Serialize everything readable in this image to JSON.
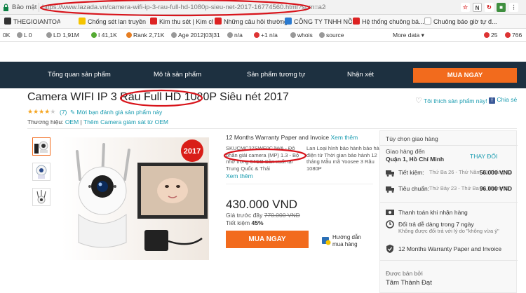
{
  "browser": {
    "secure_label": "Bảo mật",
    "url_domain": "https://www.lazada.vn",
    "url_path": "/camera-wifi-ip-3-rau-full-hd-1080p-sieu-net-2017-16774560.html?spm=a2o4n.search.products-list.31.20f9e719s9...",
    "colors": {
      "annotation": "#d8141b",
      "accent": "#f26b1d"
    }
  },
  "bookmarks": [
    {
      "label": "THEGIOIANTOAN.VN",
      "icon": "tgat-icon"
    },
    {
      "label": "Chống sét lan truyền",
      "icon": "bookmark-icon"
    },
    {
      "label": "Kim thu sét | Kim ch...",
      "icon": "bookmark-icon"
    },
    {
      "label": "Những câu hỏi thường...",
      "icon": "bookmark-icon"
    },
    {
      "label": "CÔNG TY TNHH NỒI...",
      "icon": "company-icon"
    },
    {
      "label": "Hệ thống chuông bá...",
      "icon": "bell-icon"
    },
    {
      "label": "Chuông báo giờ tự đ...",
      "icon": "page-icon"
    }
  ],
  "seobar": {
    "items": [
      "0K",
      "L 0",
      "LD 1,91M",
      "I 41,1K",
      "Rank 2,71K",
      "Age 2012|03|31",
      "n/a",
      "+1 n/a",
      "whois",
      "source",
      "More data ▾",
      "25",
      "766"
    ]
  },
  "nav": {
    "items": [
      "Tổng quan sản phẩm",
      "Mô tả sản phẩm",
      "Sản phẩm tương tự",
      "Nhận xét"
    ],
    "buy_label": "MUA NGAY"
  },
  "product": {
    "title": "Camera WIFI IP 3 Râu Full HD 1080P Siêu nét 2017",
    "rating_stars": 4,
    "rating_count": "(7)",
    "ask_label": "Mời bạn đánh giá sản phẩm này",
    "brand_label": "Thương hiệu:",
    "brand_name": "OEM",
    "brand_sep": "|",
    "brand_more": "Thêm Camera giám sát từ OEM",
    "wishlist": "Tôi thích sản phẩm này!",
    "share": "Chia sẻ",
    "badge_year": "2017"
  },
  "details": {
    "warranty": "12 Months Warranty Paper and Invoice",
    "warranty_more": "Xem thêm",
    "spec_left": "SKUCMC27SWF0CJWA - Độ phân giải camera (MP) 1.3 - Bộ nhớ trong 64GB Sản xuất tại Trung Quốc & Thái",
    "spec_right": "Lan Loại hình bảo hành bảo hành điện tử Thời gian bảo hành 12 tháng Mẫu mã Yoosee 3 Râu 1080P",
    "see_more": "Xem thêm",
    "price": "430.000 VND",
    "old_price_label": "Giá trước đây",
    "old_price": "770.000 VND",
    "save_label": "Tiết kiệm",
    "save_value": "45%",
    "buy_label": "MUA NGAY",
    "guide_label_1": "Hướng dẫn",
    "guide_label_2": "mua hàng"
  },
  "delivery": {
    "options_label": "Tùy chọn giao hàng",
    "ship_to": "Giao hàng đến",
    "location": "Quận 1, Hồ Chí Minh",
    "change": "THAY ĐỔI",
    "methods": [
      {
        "name": "Tiết kiệm:",
        "date": "Thứ Ba 26 - Thứ Năm 28 Tháng 12",
        "price": "56.000 VND"
      },
      {
        "name": "Tiêu chuẩn:",
        "date": "Thứ Bảy 23 - Thứ Ba 26 Tháng 12",
        "price": "96.000 VND"
      }
    ],
    "services": [
      {
        "text": "Thanh toán khi nhận hàng",
        "sub": ""
      },
      {
        "text": "Đổi trả dễ dàng trong 7 ngày",
        "sub": "Không được đổi trả với lý do \"không vừa ý\""
      },
      {
        "text": "12 Months Warranty Paper and Invoice",
        "sub": ""
      }
    ],
    "seller_label": "Được bán bởi",
    "seller_name": "Tâm Thành Đạt"
  }
}
